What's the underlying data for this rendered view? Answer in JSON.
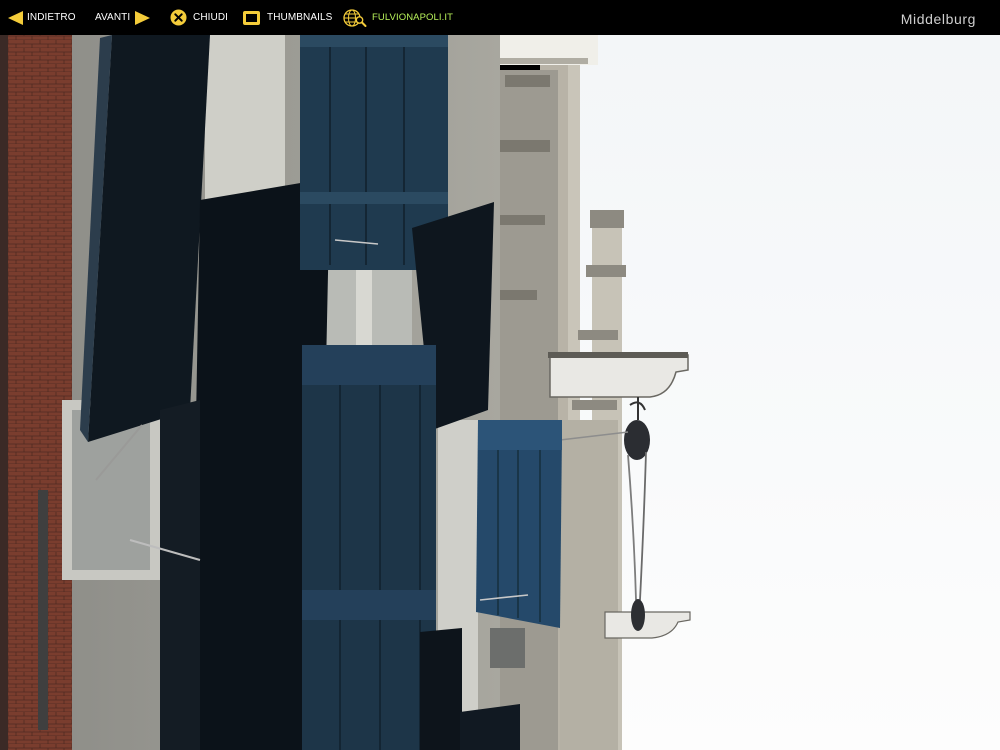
{
  "nav": {
    "back": {
      "label": "INDIETRO",
      "icon": "arrow-left-icon"
    },
    "forward": {
      "label": "AVANTI",
      "icon": "arrow-right-icon"
    },
    "close": {
      "label": "CHIUDI",
      "icon": "close-circle-icon"
    },
    "thumbnails": {
      "label": "THUMBNAILS",
      "icon": "thumbnails-icon"
    },
    "site": {
      "label": "FULVIONAPOLI.IT",
      "icon": "globe-search-icon"
    }
  },
  "photo_title": "Middelburg",
  "colors": {
    "bar_bg": "#000000",
    "icon_yellow": "#f4cc3a",
    "site_green": "#b8f25a",
    "shutter_blue": "#1e3a4e",
    "sky": "#fbfcfd"
  }
}
